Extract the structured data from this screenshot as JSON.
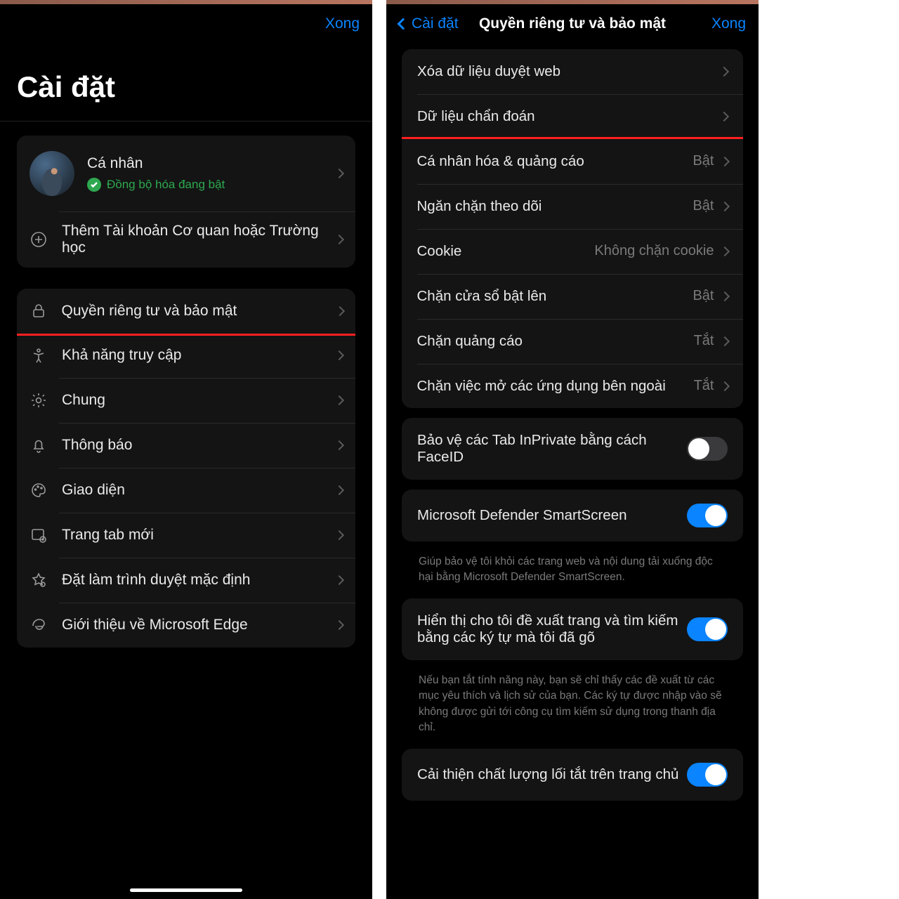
{
  "left": {
    "done": "Xong",
    "title": "Cài đặt",
    "profile": {
      "name": "Cá nhân",
      "sync": "Đồng bộ hóa đang bật"
    },
    "addAccount": "Thêm Tài khoản Cơ quan hoặc Trường học",
    "items": [
      {
        "key": "privacy",
        "label": "Quyền riêng tư và bảo mật"
      },
      {
        "key": "accessibility",
        "label": "Khả năng truy cập"
      },
      {
        "key": "general",
        "label": "Chung"
      },
      {
        "key": "notifications",
        "label": "Thông báo"
      },
      {
        "key": "appearance",
        "label": "Giao diện"
      },
      {
        "key": "newtab",
        "label": "Trang tab mới"
      },
      {
        "key": "default",
        "label": "Đặt làm trình duyệt mặc định"
      },
      {
        "key": "about",
        "label": "Giới thiệu về Microsoft Edge"
      }
    ]
  },
  "right": {
    "back": "Cài đặt",
    "title": "Quyền riêng tư và bảo mật",
    "done": "Xong",
    "group1": [
      {
        "label": "Xóa dữ liệu duyệt web",
        "value": ""
      },
      {
        "label": "Dữ liệu chẩn đoán",
        "value": ""
      },
      {
        "label": "Cá nhân hóa & quảng cáo",
        "value": "Bật"
      },
      {
        "label": "Ngăn chặn theo dõi",
        "value": "Bật"
      },
      {
        "label": "Cookie",
        "value": "Không chặn cookie"
      },
      {
        "label": "Chặn cửa sổ bật lên",
        "value": "Bật"
      },
      {
        "label": "Chặn quảng cáo",
        "value": "Tắt"
      },
      {
        "label": "Chặn việc mở các ứng dụng bên ngoài",
        "value": "Tắt"
      }
    ],
    "inprivate": {
      "label": "Bảo vệ các Tab InPrivate bằng cách FaceID",
      "on": false
    },
    "smartscreen": {
      "label": "Microsoft Defender SmartScreen",
      "on": true,
      "help": "Giúp bảo vệ tôi khỏi các trang web và nội dung tải xuống độc hại bằng Microsoft Defender SmartScreen."
    },
    "suggestions": {
      "label": "Hiển thị cho tôi đề xuất trang và tìm kiếm bằng các ký tự mà tôi đã gõ",
      "on": true,
      "help": "Nếu bạn tắt tính năng này, bạn sẽ chỉ thấy các đề xuất từ các mục yêu thích và lịch sử của bạn. Các ký tự được nhập vào sẽ không được gửi tới công cụ tìm kiếm sử dụng trong thanh địa chỉ."
    },
    "shortcut": {
      "label": "Cải thiện chất lượng lối tắt trên trang chủ",
      "on": true
    }
  }
}
